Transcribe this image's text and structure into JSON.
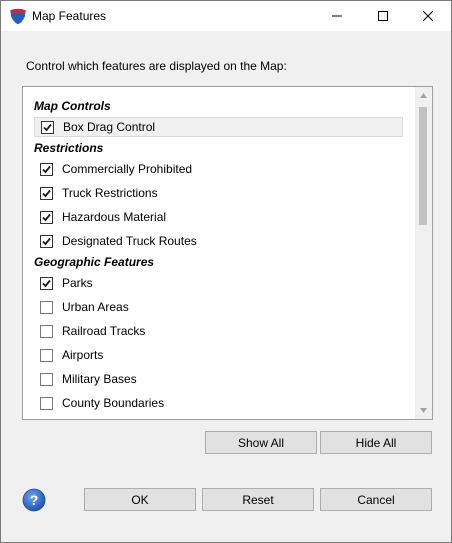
{
  "window": {
    "title": "Map Features",
    "icon": "app-shield-icon",
    "controls": [
      "minimize-icon",
      "maximize-icon",
      "close-icon"
    ]
  },
  "description": "Control which features are displayed on the Map:",
  "groups": [
    {
      "header": "Map Controls",
      "items": [
        {
          "label": "Box Drag Control",
          "checked": true,
          "selected": true
        }
      ]
    },
    {
      "header": "Restrictions",
      "items": [
        {
          "label": "Commercially Prohibited",
          "checked": true
        },
        {
          "label": "Truck Restrictions",
          "checked": true
        },
        {
          "label": "Hazardous Material",
          "checked": true
        },
        {
          "label": "Designated Truck Routes",
          "checked": true
        }
      ]
    },
    {
      "header": "Geographic Features",
      "items": [
        {
          "label": "Parks",
          "checked": true
        },
        {
          "label": "Urban Areas",
          "checked": false
        },
        {
          "label": "Railroad Tracks",
          "checked": false
        },
        {
          "label": "Airports",
          "checked": false
        },
        {
          "label": "Military Bases",
          "checked": false
        },
        {
          "label": "County Boundaries",
          "checked": false
        }
      ]
    }
  ],
  "buttons": {
    "show_all": "Show All",
    "hide_all": "Hide All",
    "ok": "OK",
    "reset": "Reset",
    "cancel": "Cancel"
  },
  "colors": {
    "accent_blue": "#1f5fbf",
    "shield_red": "#d42a2a",
    "help_blue": "#2e6bd1"
  }
}
